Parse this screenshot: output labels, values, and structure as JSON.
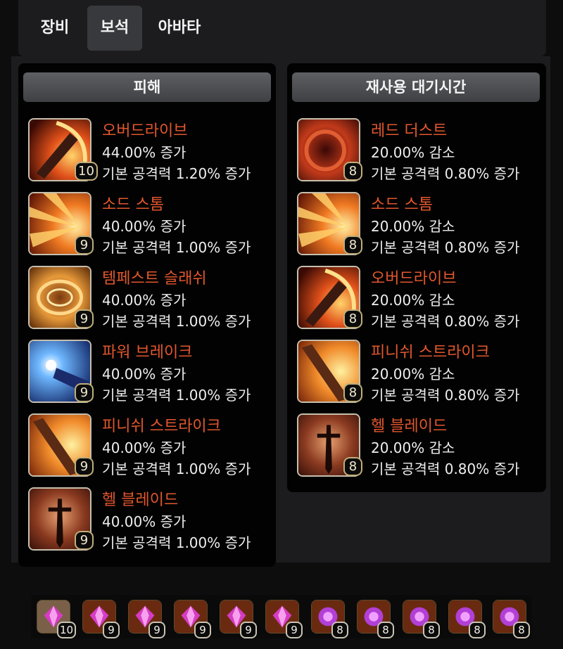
{
  "tabs": [
    {
      "label": "장비",
      "active": false
    },
    {
      "label": "보석",
      "active": true
    },
    {
      "label": "아바타",
      "active": false
    }
  ],
  "damage_panel": {
    "title": "피해",
    "items": [
      {
        "name": "오버드라이브",
        "effect": "44.00% 증가",
        "base": "기본 공격력 1.20% 증가",
        "level": "10",
        "icon": "overdrive-icon"
      },
      {
        "name": "소드 스톰",
        "effect": "40.00% 증가",
        "base": "기본 공격력 1.00% 증가",
        "level": "9",
        "icon": "sword-storm-icon"
      },
      {
        "name": "템페스트 슬래쉬",
        "effect": "40.00% 증가",
        "base": "기본 공격력 1.00% 증가",
        "level": "9",
        "icon": "tempest-slash-icon"
      },
      {
        "name": "파워 브레이크",
        "effect": "40.00% 증가",
        "base": "기본 공격력 1.00% 증가",
        "level": "9",
        "icon": "power-break-icon"
      },
      {
        "name": "피니쉬 스트라이크",
        "effect": "40.00% 증가",
        "base": "기본 공격력 1.00% 증가",
        "level": "9",
        "icon": "finish-strike-icon"
      },
      {
        "name": "헬 블레이드",
        "effect": "40.00% 증가",
        "base": "기본 공격력 1.00% 증가",
        "level": "9",
        "icon": "hell-blade-icon"
      }
    ]
  },
  "cooldown_panel": {
    "title": "재사용 대기시간",
    "items": [
      {
        "name": "레드 더스트",
        "effect": "20.00% 감소",
        "base": "기본 공격력 0.80% 증가",
        "level": "8",
        "icon": "red-dust-icon"
      },
      {
        "name": "소드 스톰",
        "effect": "20.00% 감소",
        "base": "기본 공격력 0.80% 증가",
        "level": "8",
        "icon": "sword-storm-icon"
      },
      {
        "name": "오버드라이브",
        "effect": "20.00% 감소",
        "base": "기본 공격력 0.80% 증가",
        "level": "8",
        "icon": "overdrive-icon"
      },
      {
        "name": "피니쉬 스트라이크",
        "effect": "20.00% 감소",
        "base": "기본 공격력 0.80% 증가",
        "level": "8",
        "icon": "finish-strike-icon"
      },
      {
        "name": "헬 블레이드",
        "effect": "20.00% 감소",
        "base": "기본 공격력 0.80% 증가",
        "level": "8",
        "icon": "hell-blade-icon"
      }
    ]
  },
  "gems": [
    {
      "level": "10",
      "type": "damage",
      "icon": "gem-damage-icon"
    },
    {
      "level": "9",
      "type": "damage",
      "icon": "gem-damage-icon"
    },
    {
      "level": "9",
      "type": "damage",
      "icon": "gem-damage-icon"
    },
    {
      "level": "9",
      "type": "damage",
      "icon": "gem-damage-icon"
    },
    {
      "level": "9",
      "type": "damage",
      "icon": "gem-damage-icon"
    },
    {
      "level": "9",
      "type": "damage",
      "icon": "gem-damage-icon"
    },
    {
      "level": "8",
      "type": "cooldown",
      "icon": "gem-cooldown-icon"
    },
    {
      "level": "8",
      "type": "cooldown",
      "icon": "gem-cooldown-icon"
    },
    {
      "level": "8",
      "type": "cooldown",
      "icon": "gem-cooldown-icon"
    },
    {
      "level": "8",
      "type": "cooldown",
      "icon": "gem-cooldown-icon"
    },
    {
      "level": "8",
      "type": "cooldown",
      "icon": "gem-cooldown-icon"
    }
  ],
  "colors": {
    "skill_name": "#e2572d",
    "text": "#eeeeee",
    "panel_bg": "#020202",
    "header_bg": "#4f5054",
    "active_tab_bg": "#38393c",
    "gem_damage": "#d63cc4",
    "gem_cooldown": "#b23fd6"
  }
}
